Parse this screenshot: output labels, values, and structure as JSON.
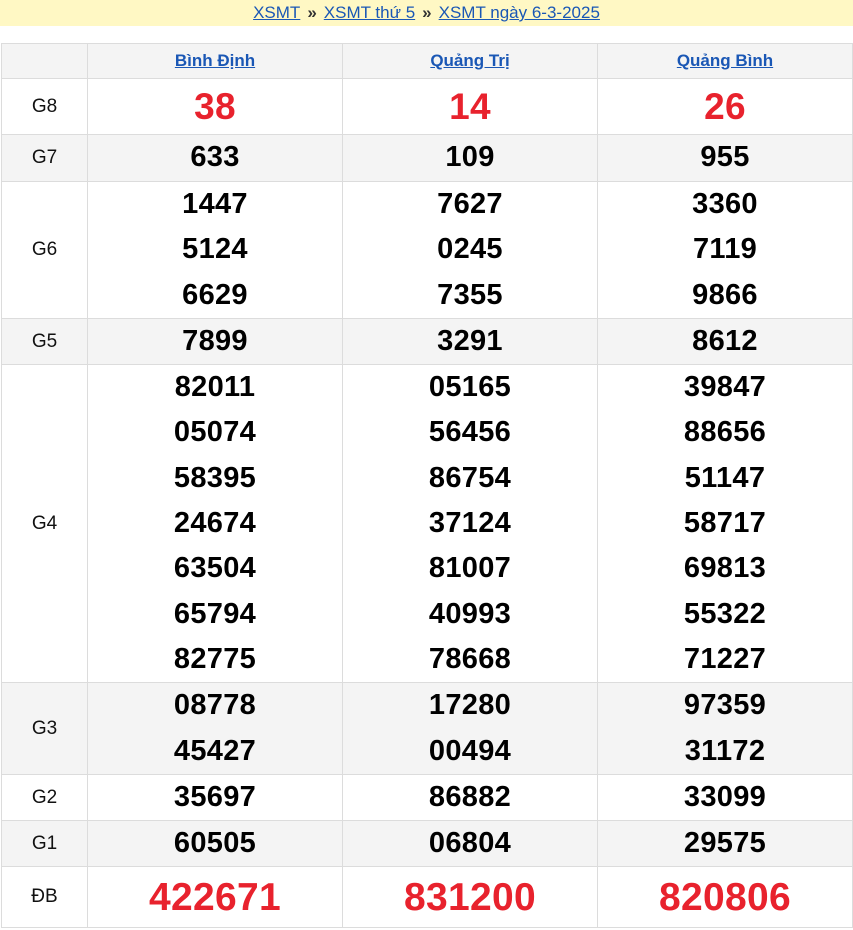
{
  "breadcrumb": {
    "items": [
      "XSMT",
      "XSMT thứ 5",
      "XSMT ngày 6-3-2025"
    ],
    "separator": "»"
  },
  "colors": {
    "breadcrumb_bg": "#fff8c4",
    "link": "#1a57b5",
    "highlight": "#e8222d",
    "alt_row": "#f4f4f4"
  },
  "provinces": [
    "Bình Định",
    "Quảng Trị",
    "Quảng Bình"
  ],
  "prizes": [
    {
      "label": "G8",
      "values": [
        [
          "38"
        ],
        [
          "14"
        ],
        [
          "26"
        ]
      ]
    },
    {
      "label": "G7",
      "values": [
        [
          "633"
        ],
        [
          "109"
        ],
        [
          "955"
        ]
      ]
    },
    {
      "label": "G6",
      "values": [
        [
          "1447",
          "5124",
          "6629"
        ],
        [
          "7627",
          "0245",
          "7355"
        ],
        [
          "3360",
          "7119",
          "9866"
        ]
      ]
    },
    {
      "label": "G5",
      "values": [
        [
          "7899"
        ],
        [
          "3291"
        ],
        [
          "8612"
        ]
      ]
    },
    {
      "label": "G4",
      "values": [
        [
          "82011",
          "05074",
          "58395",
          "24674",
          "63504",
          "65794",
          "82775"
        ],
        [
          "05165",
          "56456",
          "86754",
          "37124",
          "81007",
          "40993",
          "78668"
        ],
        [
          "39847",
          "88656",
          "51147",
          "58717",
          "69813",
          "55322",
          "71227"
        ]
      ]
    },
    {
      "label": "G3",
      "values": [
        [
          "08778",
          "45427"
        ],
        [
          "17280",
          "00494"
        ],
        [
          "97359",
          "31172"
        ]
      ]
    },
    {
      "label": "G2",
      "values": [
        [
          "35697"
        ],
        [
          "86882"
        ],
        [
          "33099"
        ]
      ]
    },
    {
      "label": "G1",
      "values": [
        [
          "60505"
        ],
        [
          "06804"
        ],
        [
          "29575"
        ]
      ]
    },
    {
      "label": "ĐB",
      "values": [
        [
          "422671"
        ],
        [
          "831200"
        ],
        [
          "820806"
        ]
      ]
    }
  ]
}
